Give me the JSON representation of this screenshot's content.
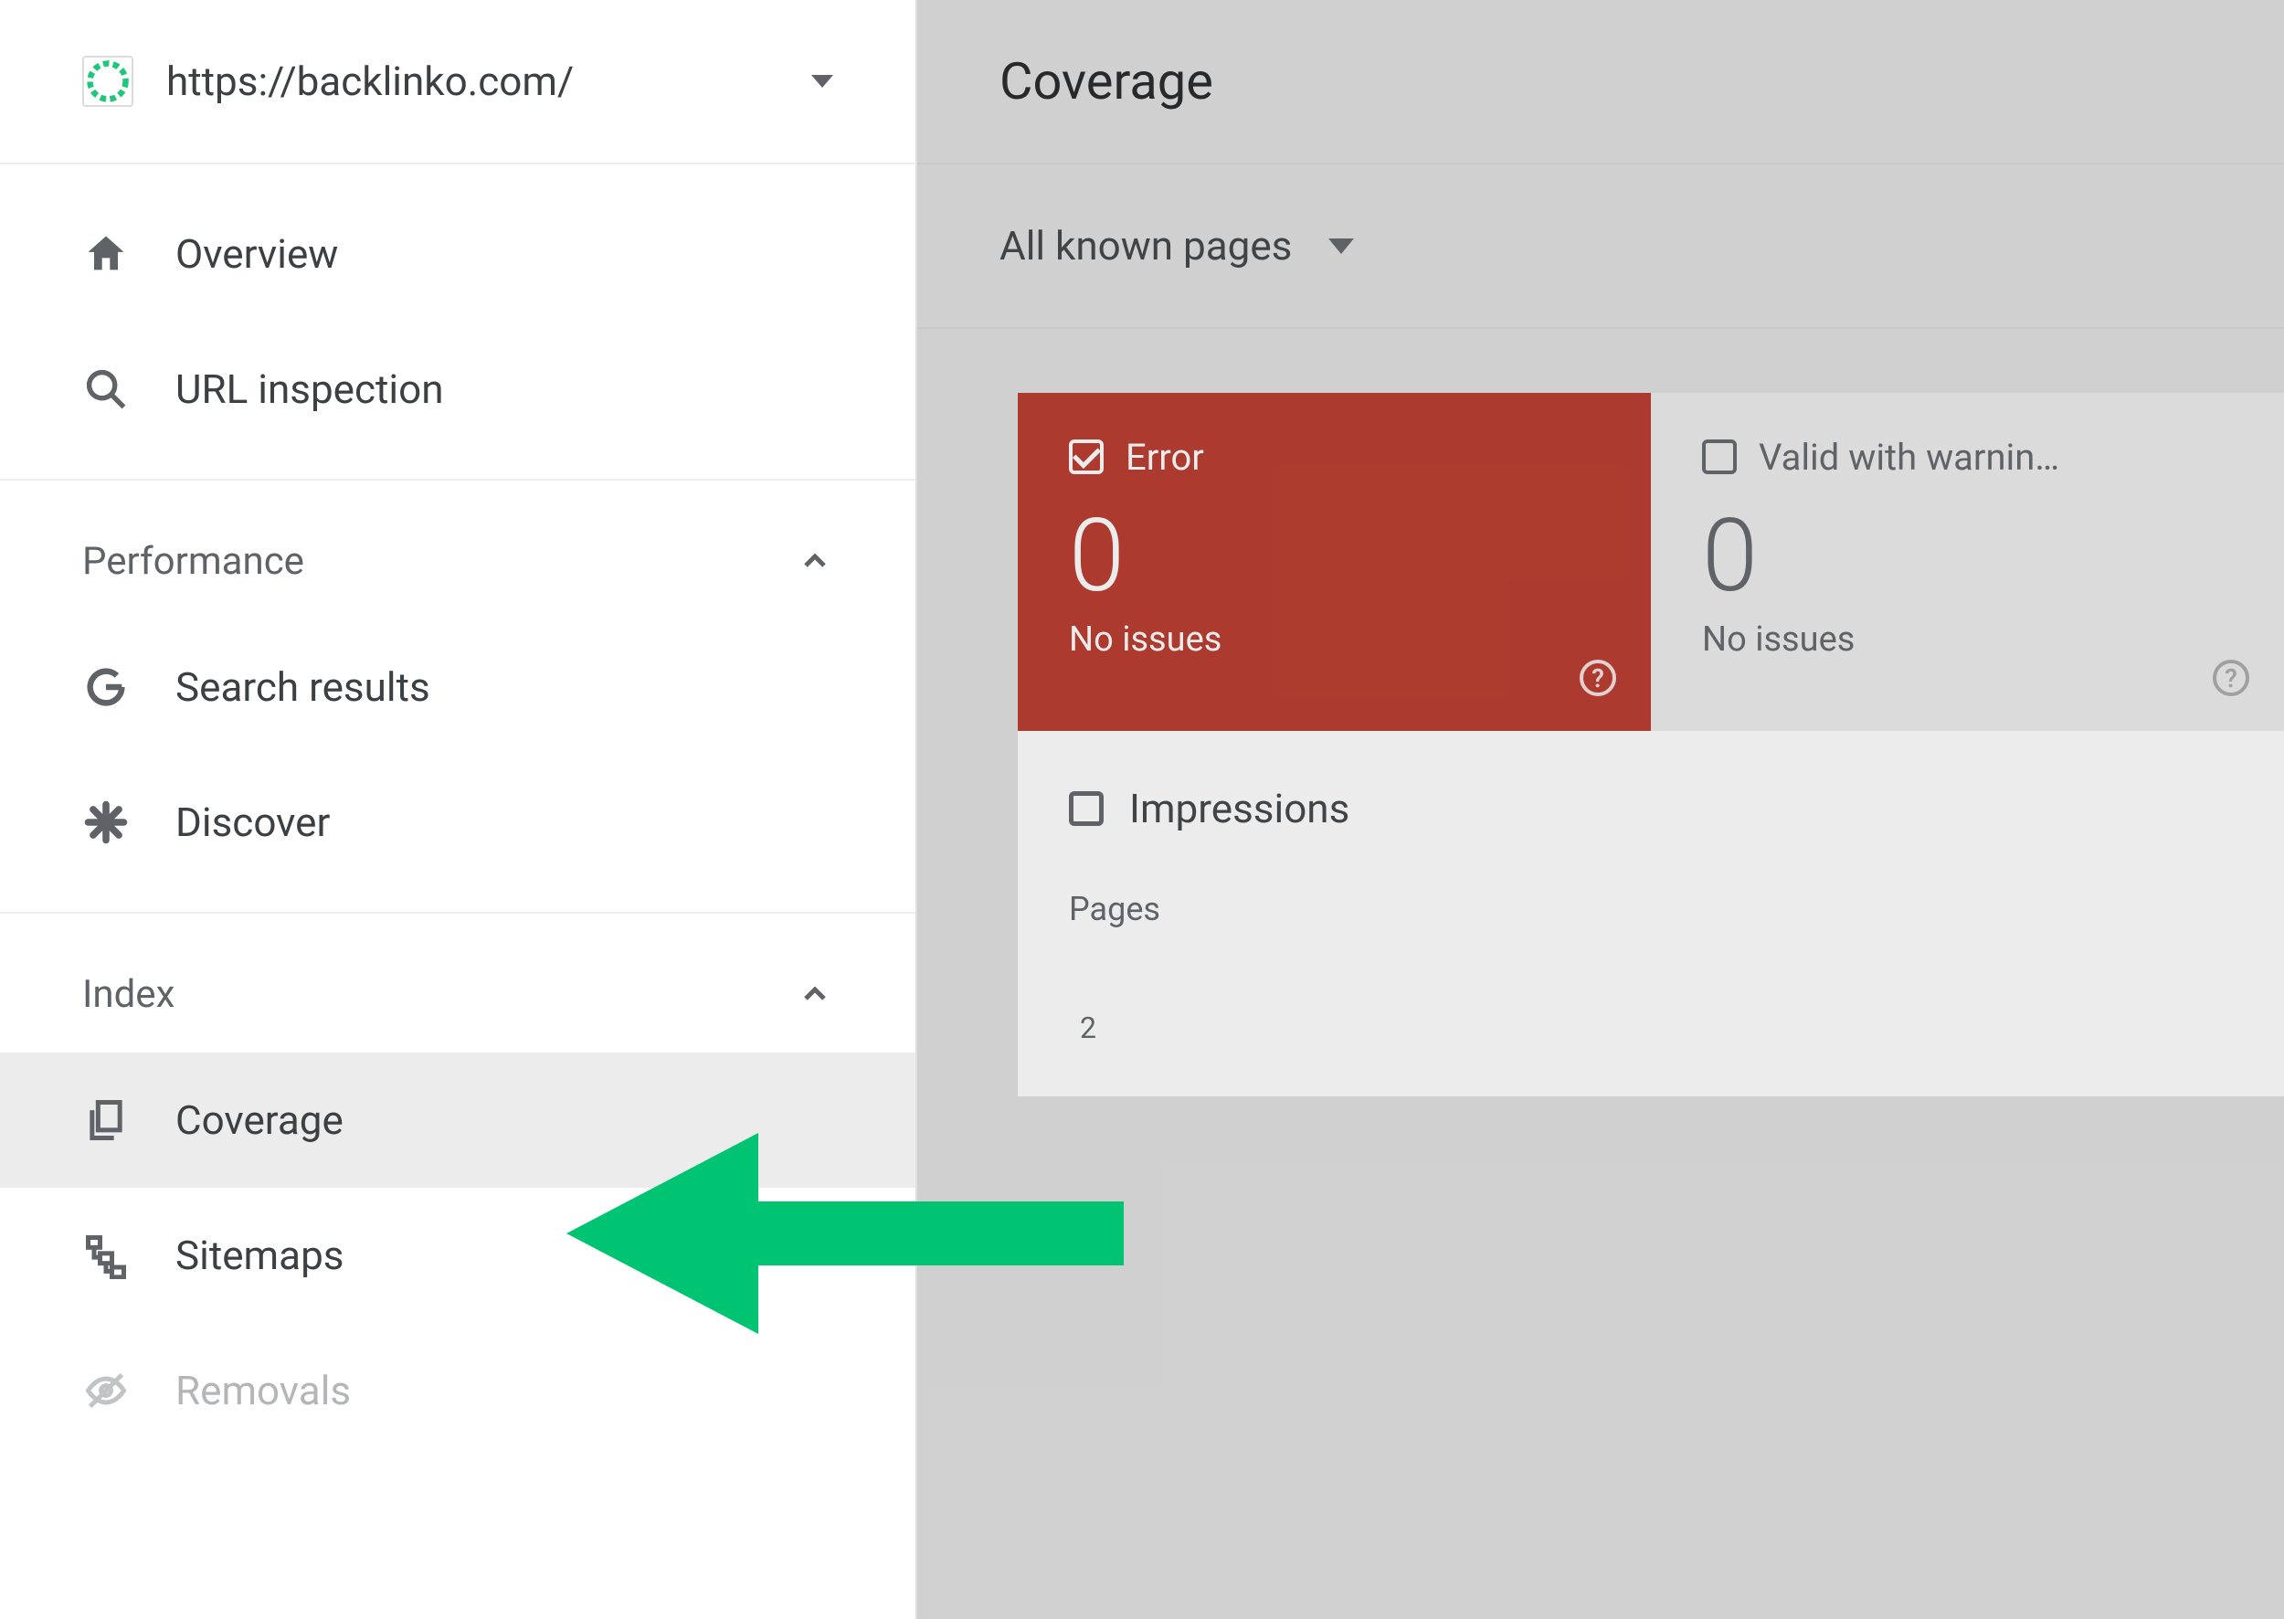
{
  "sidebar": {
    "property_url": "https://backlinko.com/",
    "top_items": [
      {
        "label": "Overview"
      },
      {
        "label": "URL inspection"
      }
    ],
    "sections": [
      {
        "title": "Performance",
        "items": [
          {
            "label": "Search results"
          },
          {
            "label": "Discover"
          }
        ]
      },
      {
        "title": "Index",
        "items": [
          {
            "label": "Coverage"
          },
          {
            "label": "Sitemaps"
          },
          {
            "label": "Removals"
          }
        ]
      }
    ]
  },
  "header": {
    "title": "Coverage"
  },
  "filter": {
    "label": "All known pages"
  },
  "cards": {
    "error": {
      "label": "Error",
      "value": "0",
      "sub": "No issues"
    },
    "warning": {
      "label": "Valid with warnin…",
      "value": "0",
      "sub": "No issues"
    }
  },
  "impressions": {
    "label": "Impressions"
  },
  "chart_area": {
    "title": "Pages",
    "axis_tick": "2"
  },
  "colors": {
    "error_bg": "#b73527",
    "arrow": "#00c471"
  }
}
